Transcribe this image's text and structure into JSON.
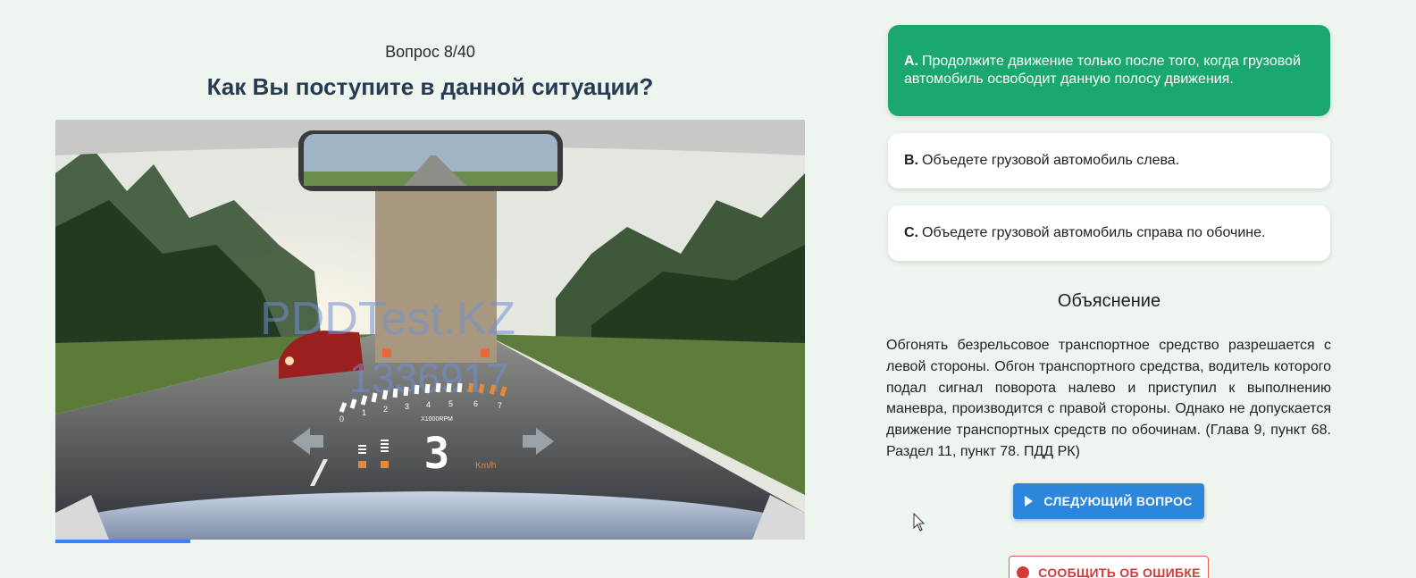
{
  "question": {
    "counter": "Вопрос 8/40",
    "title": "Как Вы поступите в данной ситуации?",
    "progress": 0.18
  },
  "media": {
    "watermark_site": "PDDTest.KZ",
    "watermark_id": "1336917",
    "rpm_unit": "X1000RPM",
    "rpm_ticks": [
      "0",
      "1",
      "2",
      "3",
      "4",
      "5",
      "6",
      "7"
    ],
    "gear": "3",
    "speed_unit": "Km/h"
  },
  "answers": [
    {
      "letter": "A.",
      "text": "Продолжите движение только после того, когда грузовой автомобиль освободит данную полосу движения.",
      "state": "correct"
    },
    {
      "letter": "B.",
      "text": "Объедете грузовой автомобиль слева.",
      "state": "default"
    },
    {
      "letter": "C.",
      "text": "Объедете грузовой автомобиль справа по обочине.",
      "state": "default"
    }
  ],
  "explanation": {
    "title": "Объяснение",
    "text": "Обгонять безрельсовое транспортное средство разрешается с левой стороны. Обгон транспортного средства, водитель которого подал сигнал поворота налево и приступил к выполнению маневра, производится с правой стороны. Однако не допускается движение транспортных средств по обочинам. (Глава 9, пункт 68. Раздел 11, пункт 78. ПДД РК)"
  },
  "buttons": {
    "next_label": "СЛЕДУЮЩИЙ ВОПРОС",
    "report_label": "СООБЩИТЬ ОБ ОШИБКЕ"
  },
  "colors": {
    "correct": "#1aa86f",
    "primary": "#2b86dc",
    "danger": "#d33a3a",
    "progress": "#3b82f6",
    "background": "#eef5ee"
  }
}
